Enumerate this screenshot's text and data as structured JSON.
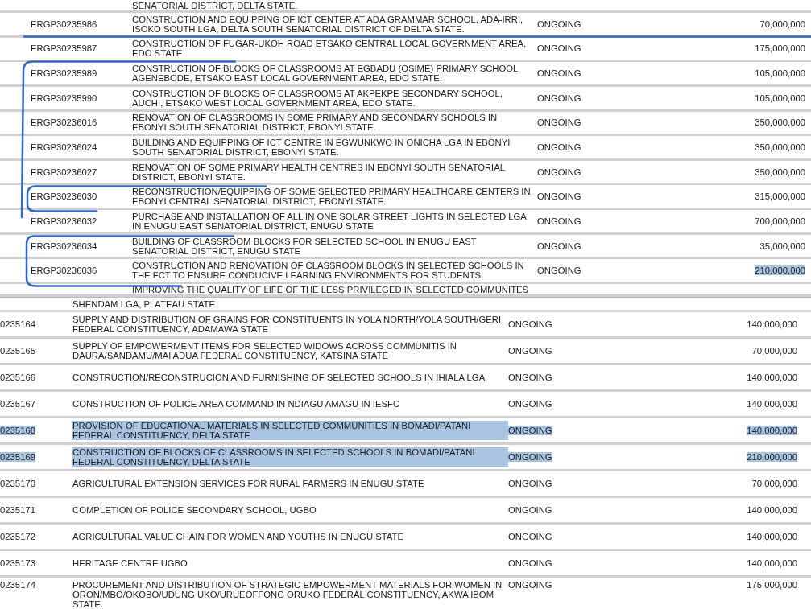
{
  "panels": [
    {
      "rows": [
        {
          "kind": "partial",
          "description": "SENATORIAL DISTRICT, DELTA STATE."
        },
        {
          "kind": "full",
          "code": "ERGP30235986",
          "description": "CONSTRUCTION AND EQUIPPING OF ICT CENTER AT ADA GRAMMAR SCHOOL, ADA-IRRI, ISOKO SOUTH LGA, DELTA SOUTH SENATORIAL DISTRICT OF DELTA STATE.",
          "status": "ONGOING",
          "amount": "70,000,000",
          "selected": false,
          "amount_selected": false
        },
        {
          "kind": "full",
          "code": "ERGP30235987",
          "description": "CONSTRUCTION OF FUGAR-UKOH ROAD ETSAKO CENTRAL LOCAL GOVERNMENT AREA, EDO STATE",
          "status": "ONGOING",
          "amount": "175,000,000",
          "selected": false,
          "amount_selected": false
        },
        {
          "kind": "full",
          "code": "ERGP30235989",
          "description": "CONSTRUCTION OF BLOCKS OF CLASSROOMS AT EGBADU (OSIME) PRIMARY SCHOOL AGENEBODE, ETSAKO EAST LOCAL GOVERNMENT AREA, EDO STATE.",
          "status": "ONGOING",
          "amount": "105,000,000",
          "selected": false,
          "amount_selected": false
        },
        {
          "kind": "full",
          "code": "ERGP30235990",
          "description": "CONSTRUCTION OF BLOCKS OF CLASSROOMS AT AKPEKPE SECONDARY SCHOOL, AUCHI, ETSAKO WEST LOCAL GOVERNMENT AREA, EDO STATE.",
          "status": "ONGOING",
          "amount": "105,000,000",
          "selected": false,
          "amount_selected": false
        },
        {
          "kind": "full",
          "code": "ERGP30236016",
          "description": "RENOVATION OF CLASSROOMS IN SOME PRIMARY AND SECONDARY SCHOOLS IN EBONYI SOUTH SENATORIAL DISTRICT, EBONYI STATE.",
          "status": "ONGOING",
          "amount": "350,000,000",
          "selected": false,
          "amount_selected": false
        },
        {
          "kind": "full",
          "code": "ERGP30236024",
          "description": "BUILDING AND EQUIPPING OF ICT CENTRE IN EGWUNKWO IN ONICHA LGA IN EBONYI SOUTH SENATORIAL DISTRICT, EBONYI STATE.",
          "status": "ONGOING",
          "amount": "350,000,000",
          "selected": false,
          "amount_selected": false
        },
        {
          "kind": "full",
          "code": "ERGP30236027",
          "description": "RENOVATION OF SOME PRIMARY HEALTH CENTRES IN EBONYI SOUTH SENATORIAL DISTRICT, EBONYI STATE.",
          "status": "ONGOING",
          "amount": "350,000,000",
          "selected": false,
          "amount_selected": false
        },
        {
          "kind": "full",
          "code": "ERGP30236030",
          "description": "RECONSTRUCTION/EQUIPPING OF SOME SELECTED PRIMARY HEALTHCARE CENTERS IN EBONYI CENTRAL SENATORIAL DISTRICT, EBONYI STATE.",
          "status": "ONGOING",
          "amount": "315,000,000",
          "selected": false,
          "amount_selected": false
        },
        {
          "kind": "full",
          "code": "ERGP30236032",
          "description": "PURCHASE AND INSTALLATION OF ALL IN ONE SOLAR STREET LIGHTS IN SELECTED LGA IN ENUGU EAST SENATORIAL DISTRICT, ENUGU STATE",
          "status": "ONGOING",
          "amount": "700,000,000",
          "selected": false,
          "amount_selected": false
        },
        {
          "kind": "full",
          "code": "ERGP30236034",
          "description": "BUILDING OF CLASSROOM BLOCKS FOR SELECTED SCHOOL IN ENUGU EAST SENATORIAL DISTRICT, ENUGU STATE",
          "status": "ONGOING",
          "amount": "35,000,000",
          "selected": false,
          "amount_selected": false
        },
        {
          "kind": "full",
          "code": "ERGP30236036",
          "description": "CONSTRUCTION AND RENOVATION OF CLASSROOM BLOCKS IN SELECTED SCHOOLS IN THE FCT TO ENSURE CONDUCIVE LEARNING ENVIRONMENTS FOR STUDENTS",
          "status": "ONGOING",
          "amount": "210,000,000",
          "selected": false,
          "amount_selected": true
        },
        {
          "kind": "partial",
          "description": "IMPROVING THE QUALITY OF LIFE OF THE LESS PRIVILEGED IN SELECTED COMMUNITES"
        }
      ]
    },
    {
      "rows": [
        {
          "kind": "partial",
          "description": "SHENDAM LGA, PLATEAU STATE"
        },
        {
          "kind": "full",
          "code": "0235164",
          "description": "SUPPLY AND DISTRIBUTION OF GRAINS FOR CONSTITUENTS IN YOLA NORTH/YOLA SOUTH/GERI FEDERAL CONSTITUENCY, ADAMAWA STATE",
          "status": "ONGOING",
          "amount": "140,000,000",
          "selected": false,
          "amount_selected": false
        },
        {
          "kind": "full",
          "code": "0235165",
          "description": "SUPPLY OF EMPOWERMENT ITEMS FOR SELECTED WIDOWS ACROSS COMMUNITIS IN DAURA/SANDAMU/MAI'ADUA FEDERAL CONSTITUENCY, KATSINA STATE",
          "status": "ONGOING",
          "amount": "70,000,000",
          "selected": false,
          "amount_selected": false
        },
        {
          "kind": "full",
          "code": "0235166",
          "description": "CONSTRUCTION/RECONSTRUCION AND FURNISHING OF SELECTED SCHOOLS IN IHIALA LGA",
          "status": "ONGOING",
          "amount": "140,000,000",
          "selected": false,
          "amount_selected": false
        },
        {
          "kind": "full",
          "code": "0235167",
          "description": "CONSTRUCTION OF POLICE AREA COMMAND IN NDIAGU AMAGU IN IESFC",
          "status": "ONGOING",
          "amount": "140,000,000",
          "selected": false,
          "amount_selected": false
        },
        {
          "kind": "full",
          "code": "0235168",
          "description": "PROVISION OF EDUCATIONAL MATERIALS IN SELECTED COMMUNITIES IN BOMADI/PATANI FEDERAL CONSTITUENCY, DELTA STATE",
          "status": "ONGOING",
          "amount": "140,000,000",
          "selected": true,
          "amount_selected": true
        },
        {
          "kind": "full",
          "code": "0235169",
          "description": "CONSTRUCTION OF BLOCKS OF CLASSROOMS IN SELECTED SCHOOLS IN BOMADI/PATANI FEDERAL CONSTITUENCY, DELTA STATE",
          "status": "ONGOING",
          "amount": "210,000,000",
          "selected": true,
          "amount_selected": true
        },
        {
          "kind": "full",
          "code": "0235170",
          "description": "AGRICULTURAL EXTENSION SERVICES FOR RURAL FARMERS IN ENUGU STATE",
          "status": "ONGOING",
          "amount": "70,000,000",
          "selected": false,
          "amount_selected": false
        },
        {
          "kind": "full",
          "code": "0235171",
          "description": "COMPLETION OF POLICE SECONDARY SCHOOL, UGBO",
          "status": "ONGOING",
          "amount": "140,000,000",
          "selected": false,
          "amount_selected": false
        },
        {
          "kind": "full",
          "code": "0235172",
          "description": "AGRICULTURAL VALUE CHAIN FOR WOMEN AND YOUTHS IN ENUGU STATE",
          "status": "ONGOING",
          "amount": "140,000,000",
          "selected": false,
          "amount_selected": false
        },
        {
          "kind": "full",
          "code": "0235173",
          "description": "HERITAGE CENTRE UGBO",
          "status": "ONGOING",
          "amount": "140,000,000",
          "selected": false,
          "amount_selected": false
        },
        {
          "kind": "full",
          "code": "0235174",
          "description": "PROCUREMENT AND DISTRIBUTION OF STRATEGIC EMPOWERMENT MATERIALS FOR WOMEN IN ORON/MBO/OKOBO/UDUNG UKO/URUEOFFONG ORUKO FEDERAL CONSTITUENCY, AKWA IBOM STATE.",
          "status": "ONGOING",
          "amount": "175,000,000",
          "selected": false,
          "amount_selected": false
        }
      ]
    }
  ]
}
